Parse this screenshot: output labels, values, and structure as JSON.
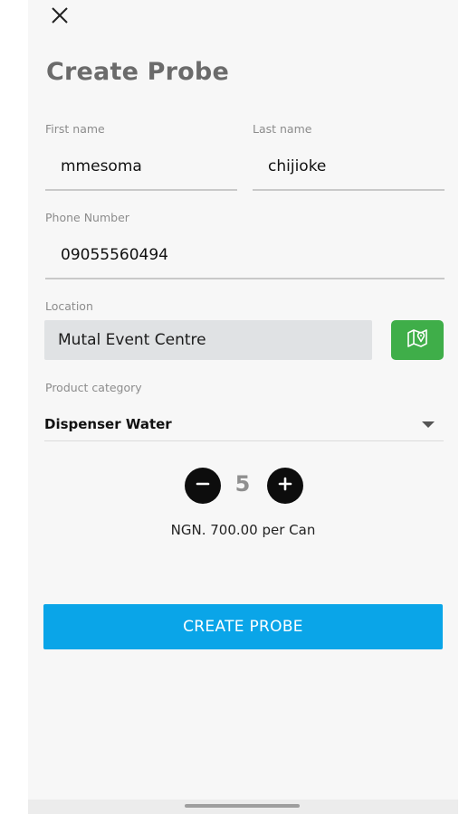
{
  "header": {
    "close_icon": "close-icon",
    "title": "Create Probe"
  },
  "form": {
    "first_name": {
      "label": "First name",
      "value": "mmesoma"
    },
    "last_name": {
      "label": "Last name",
      "value": "chijioke"
    },
    "phone": {
      "label": "Phone Number",
      "value": "09055560494"
    },
    "location": {
      "label": "Location",
      "value": "Mutal Event Centre",
      "map_icon": "map-pin-icon"
    },
    "product_category": {
      "label": "Product category",
      "value": "Dispenser Water"
    },
    "quantity": {
      "value": "5",
      "decrement_icon": "minus-icon",
      "increment_icon": "plus-icon"
    },
    "price": "NGN. 700.00 per Can"
  },
  "actions": {
    "submit_label": "CREATE PROBE"
  },
  "colors": {
    "accent_blue": "#0aa5e8",
    "map_green": "#3fae49",
    "title_gray": "#6b6b6b"
  }
}
